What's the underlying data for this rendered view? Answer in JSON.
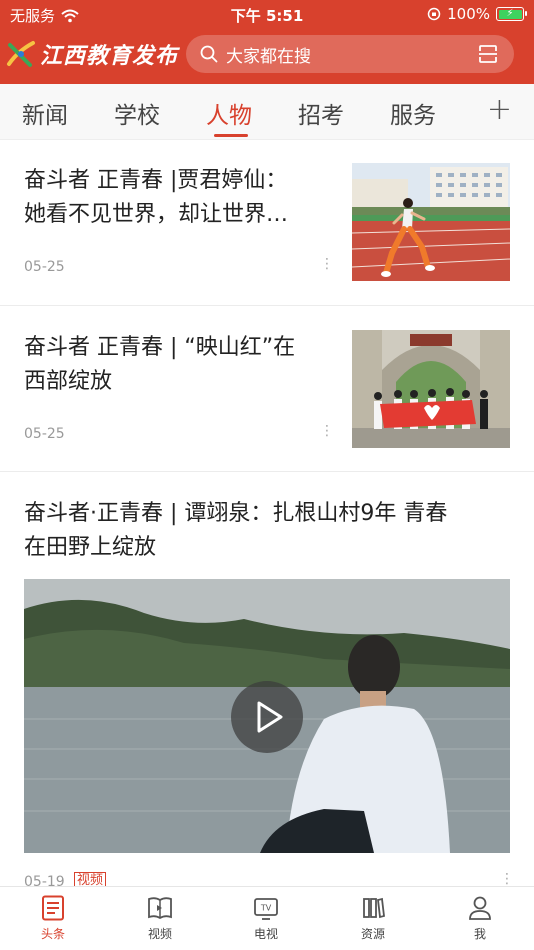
{
  "status_bar": {
    "carrier": "无服务",
    "time": "下午 5:51",
    "battery": "100%"
  },
  "header": {
    "logo_text": "江西教育发布",
    "search_placeholder": "大家都在搜",
    "accent_color": "#d8412d"
  },
  "tabs": [
    {
      "label": "新闻",
      "active": false
    },
    {
      "label": "学校",
      "active": false
    },
    {
      "label": "人物",
      "active": true
    },
    {
      "label": "招考",
      "active": false
    },
    {
      "label": "服务",
      "active": false
    }
  ],
  "add_tab_label": "+",
  "articles": [
    {
      "title_line1": "奋斗者 正青春 |贾君婷仙：",
      "title_line2": "她看不见世界，却让世界…",
      "date": "05-25"
    },
    {
      "title_line1": "奋斗者 正青春 | “映山红”在",
      "title_line2": "西部绽放",
      "date": "05-25"
    },
    {
      "title_line1": "奋斗者·正青春 | 谭翊泉：扎根山村9年  青春",
      "title_line2": "在田野上绽放",
      "date": "05-19",
      "badge": "视频"
    }
  ],
  "bottom_nav": [
    {
      "label": "头条",
      "icon": "headline-icon",
      "active": true
    },
    {
      "label": "视频",
      "icon": "video-book-icon",
      "active": false
    },
    {
      "label": "电视",
      "icon": "tv-icon",
      "active": false
    },
    {
      "label": "资源",
      "icon": "resource-icon",
      "active": false
    },
    {
      "label": "我",
      "icon": "profile-icon",
      "active": false
    }
  ]
}
